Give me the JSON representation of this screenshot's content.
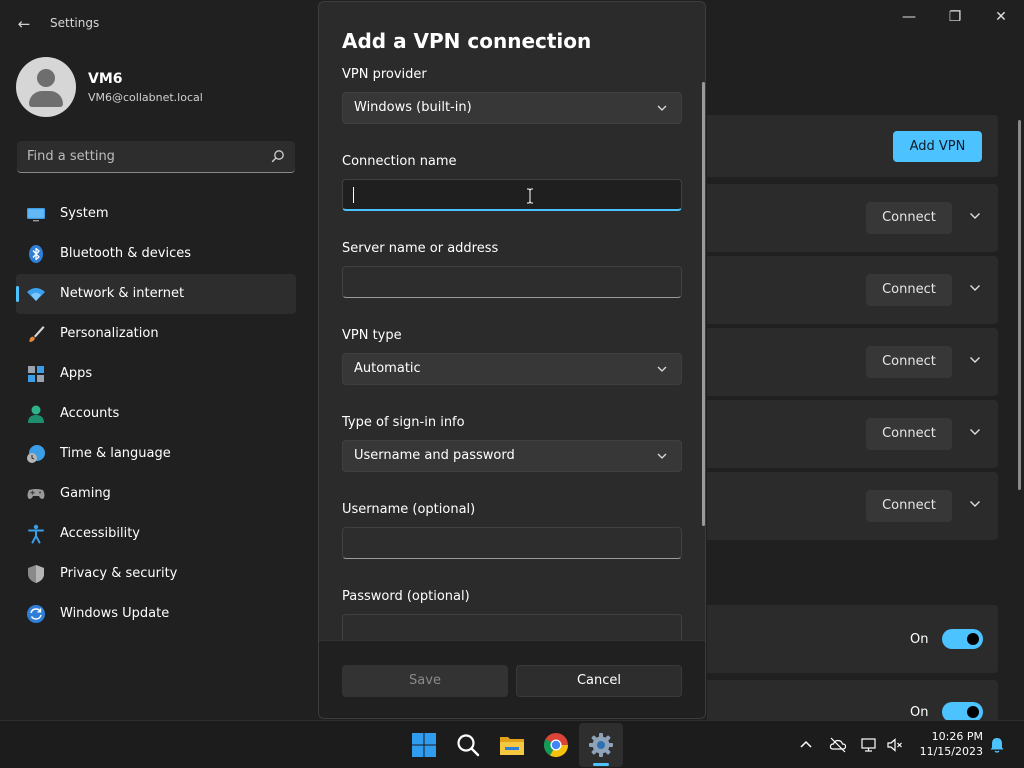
{
  "window": {
    "title": "Settings",
    "back_glyph": "←",
    "minimize_glyph": "—",
    "maximize_glyph": "❐",
    "close_glyph": "✕"
  },
  "profile": {
    "name": "VM6",
    "email": "VM6@collabnet.local"
  },
  "search": {
    "placeholder": "Find a setting"
  },
  "sidebar": {
    "items": [
      {
        "label": "System",
        "icon": "monitor-icon"
      },
      {
        "label": "Bluetooth & devices",
        "icon": "bluetooth-icon"
      },
      {
        "label": "Network & internet",
        "icon": "wifi-icon",
        "selected": true
      },
      {
        "label": "Personalization",
        "icon": "paintbrush-icon"
      },
      {
        "label": "Apps",
        "icon": "apps-icon"
      },
      {
        "label": "Accounts",
        "icon": "person-icon"
      },
      {
        "label": "Time & language",
        "icon": "globe-clock-icon"
      },
      {
        "label": "Gaming",
        "icon": "gamepad-icon"
      },
      {
        "label": "Accessibility",
        "icon": "accessibility-icon"
      },
      {
        "label": "Privacy & security",
        "icon": "shield-icon"
      },
      {
        "label": "Windows Update",
        "icon": "update-icon"
      }
    ]
  },
  "content": {
    "add_vpn_label": "Add VPN",
    "vpn_rows": [
      {
        "connect_label": "Connect"
      },
      {
        "connect_label": "Connect"
      },
      {
        "connect_label": "Connect"
      },
      {
        "connect_label": "Connect"
      },
      {
        "connect_label": "Connect"
      }
    ],
    "toggles": [
      {
        "state_label": "On",
        "on": true
      },
      {
        "state_label": "On",
        "on": true
      }
    ]
  },
  "dialog": {
    "title": "Add a VPN connection",
    "vpn_provider": {
      "label": "VPN provider",
      "value": "Windows (built-in)"
    },
    "connection_name": {
      "label": "Connection name",
      "value": ""
    },
    "server": {
      "label": "Server name or address",
      "value": ""
    },
    "vpn_type": {
      "label": "VPN type",
      "value": "Automatic"
    },
    "signin_type": {
      "label": "Type of sign-in info",
      "value": "Username and password"
    },
    "username": {
      "label": "Username (optional)",
      "value": ""
    },
    "password": {
      "label": "Password (optional)",
      "value": ""
    },
    "save_label": "Save",
    "cancel_label": "Cancel"
  },
  "taskbar": {
    "apps": [
      "windows-start-icon",
      "search-icon",
      "file-explorer-icon",
      "chrome-icon",
      "settings-gear-icon"
    ],
    "time": "10:26 PM",
    "date": "11/15/2023"
  },
  "colors": {
    "accent": "#4cc2ff",
    "background": "#202020",
    "dialog": "#2b2b2b"
  }
}
